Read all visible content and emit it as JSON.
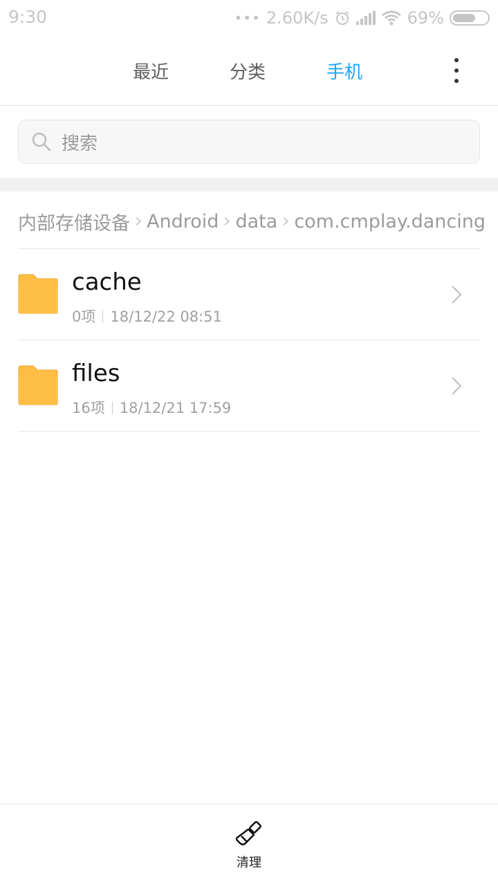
{
  "status_bar": {
    "time": "9:30",
    "dots": "•••",
    "speed": "2.60K/s",
    "battery_percent": "69%",
    "battery_level": 0.69
  },
  "tabs": [
    {
      "label": "最近",
      "active": false
    },
    {
      "label": "分类",
      "active": false
    },
    {
      "label": "手机",
      "active": true
    }
  ],
  "colors": {
    "accent": "#1ea4ff",
    "folder": "#ffbd44"
  },
  "search": {
    "placeholder": "搜索"
  },
  "breadcrumb": [
    "内部存储设备",
    "Android",
    "data",
    "com.cmplay.dancing"
  ],
  "files": [
    {
      "name": "cache",
      "count": "0项",
      "modified": "18/12/22 08:51"
    },
    {
      "name": "files",
      "count": "16项",
      "modified": "18/12/21 17:59"
    }
  ],
  "bottom_bar": {
    "clean_label": "清理"
  },
  "icons": {
    "search": "search-icon",
    "more": "more-vertical-icon",
    "folder": "folder-icon",
    "chevron": "chevron-right-icon",
    "clean": "brush-icon"
  }
}
